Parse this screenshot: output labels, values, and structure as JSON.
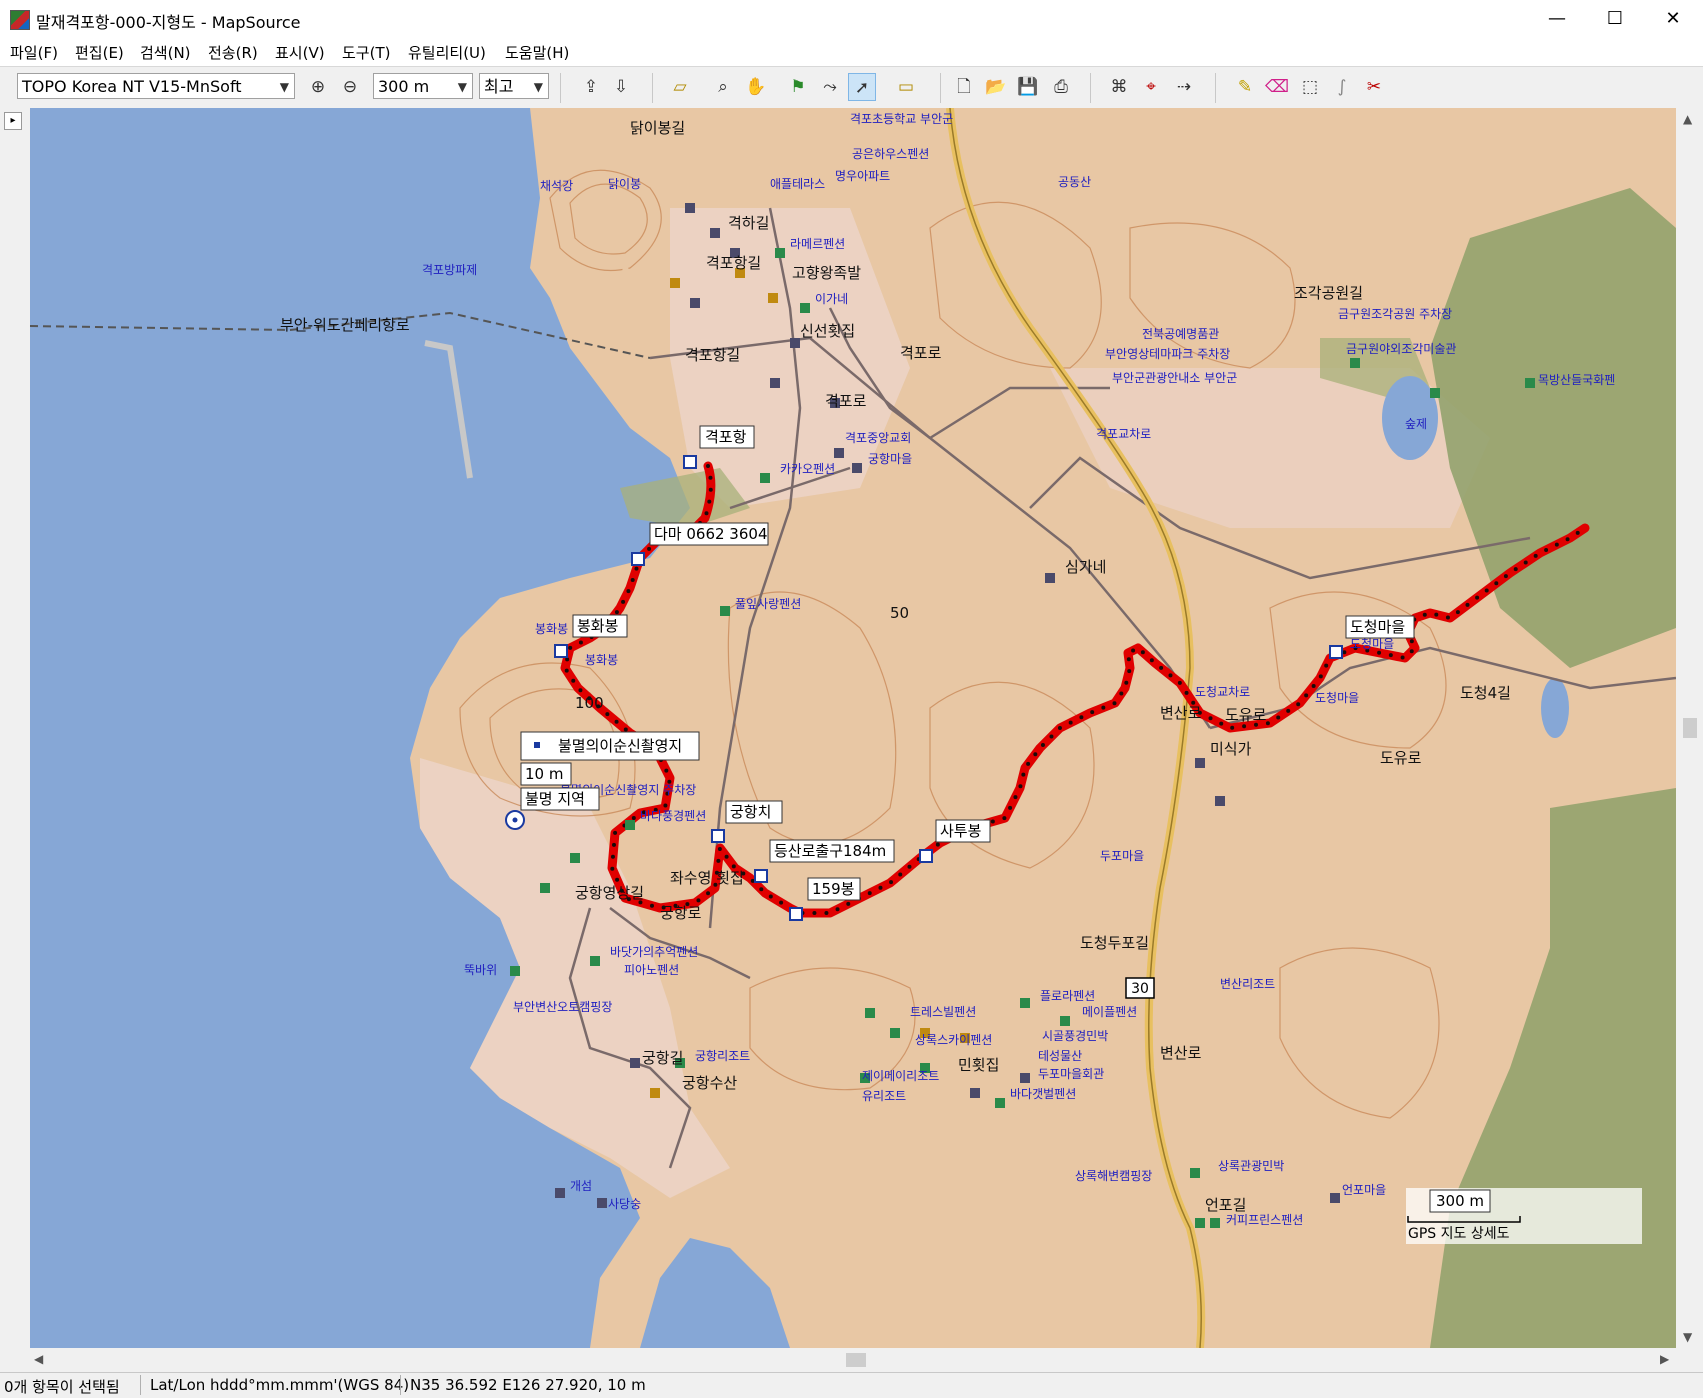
{
  "window": {
    "title": "말재격포항-000-지형도 - MapSource",
    "minimize_glyph": "—",
    "maximize_glyph": "☐",
    "close_glyph": "✕"
  },
  "menu": [
    "파일(F)",
    "편집(E)",
    "검색(N)",
    "전송(R)",
    "표시(V)",
    "도구(T)",
    "유틸리티(U)",
    "도움말(H)"
  ],
  "toolbar": {
    "map_product": "TOPO Korea NT V15-MnSoft",
    "zoom_scale": "300 m",
    "detail_level": "최고",
    "icons": [
      "zoom-in-icon",
      "zoom-out-icon",
      "receive-from-device-icon",
      "send-to-device-icon",
      "select-map-icon",
      "zoom-tool-icon",
      "hand-tool-icon",
      "waypoint-tool-icon",
      "route-tool-icon",
      "selection-tool-icon",
      "measure-tool-icon",
      "new-file-icon",
      "open-file-icon",
      "save-file-icon",
      "print-icon",
      "find-icon",
      "find-near-icon",
      "find-route-icon",
      "draw-track-icon",
      "erase-track-icon",
      "select-track-icon",
      "divide-track-icon",
      "join-track-icon"
    ]
  },
  "map": {
    "labels": {
      "gyeokpohang": "격포항",
      "dama": "다마 0662 3604",
      "bonghwabong": "봉화봉",
      "bulmyeong_poi": "불멸의이순신촬영지",
      "elevation": "10 m",
      "unknown_area": "불명 지역",
      "gunghangchi": "궁항치",
      "exit": "등산로출구184m",
      "peak159": "159봉",
      "satubong": "사투봉",
      "docheong": "도청마을",
      "route30": "30"
    },
    "place_names": {
      "dalibonggil": "닭이봉길",
      "dalibong": "닭이봉",
      "chaeseokgang": "채석강",
      "gyeokpo_breakwater": "격포방파제",
      "ferry": "부안-위도간페리항로",
      "gyeokhagil": "격하길",
      "gyeokpohanggil": "격포항길",
      "gyeokpohanggil2": "격포항길",
      "gohyangwang": "고향왕족발",
      "sinseon": "신선횟집",
      "gyeokporo": "격포로",
      "gyeokporo2": "격포로",
      "school": "격포초등학교 부안군",
      "gongeunhausu": "공은하우스펜션",
      "apple": "애플테라스",
      "apt": "명우아파트",
      "lamere": "라메르펜션",
      "igane": "이가네",
      "gongdongsan": "공동산",
      "jeonbuk": "전북공예명품관",
      "parking1": "부안영상테마파크 주차장",
      "tourist": "부안군관광안내소 부안군",
      "gyeokpo_ic": "격포교차로",
      "jogak_road": "조각공원길",
      "geumgu_parking": "금구원조각공원 주차장",
      "geumgu_museum": "금구원야외조각미술관",
      "sup": "숲제",
      "mokbangsan": "목방산들국화펜",
      "simgane": "심가네",
      "kakao": "카카오펜션",
      "gyeokpo_church": "격포중앙교회",
      "gunghangmaeul": "궁항마을",
      "pulip": "풀잎사랑펜션",
      "contour50": "50",
      "contour100": "100",
      "bonghwabong_small": "봉화봉",
      "bonghwabong_small2": "봉화봉",
      "docheong_ic": "도청교차로",
      "docheongmaeul2": "도청마을",
      "docheongmaeul3": "도청마을",
      "doyuro": "도유로",
      "doyuro2": "도유로",
      "misikga": "미식가",
      "docheong4gil": "도청4길",
      "byeonsanro": "변산로",
      "byeonsanro2": "변산로",
      "dopyeondurogil": "도청두포길",
      "dupo": "두포마을",
      "jasu": "좌수영 횟집",
      "seashore": "바다풍경펜션",
      "parking2": "불멸의이순신촬영지 주차장",
      "gunghangyeongsang": "궁항영상길",
      "gunghangro": "궁항로",
      "badatga": "바닷가의추억펜션",
      "piano": "피아노펜션",
      "ttukbawi": "뚝바위",
      "auto_camp": "부안변산오토캠핑장",
      "gunghangresort": "궁항리조트",
      "gunghangsusan": "궁항수산",
      "gunghang_road": "궁항길",
      "terrace": "트레스빌펜션",
      "sky": "상록스카이펜션",
      "minhoe": "민횟집",
      "jamairi": "제이메이리조트",
      "yuri": "유리조트",
      "flora": "플로라펜션",
      "maple": "메이플펜션",
      "sigol": "시골풍경민박",
      "teseong": "테성물산",
      "dupohall": "두포마을회관",
      "badagaet": "바다갯벌펜션",
      "byeonsanresort": "변산리조트",
      "sangnokcamp": "상록해변캠핑장",
      "sangnokguest": "상록관광민박",
      "eonpo": "언포마을",
      "eonpogil": "언포길",
      "coffee": "커피프린스펜션",
      "gaeseom": "개섬",
      "sadangsu": "사당숭",
      "distance_label": "300 m",
      "legend_label": "GPS 지도 상세도"
    },
    "colors": {
      "sea": "#86a7d6",
      "land": "#e8c7a4",
      "track": "#e00000",
      "track_dots": "#1a0a0a",
      "road_major": "#e8c060",
      "road_minor": "#7a6a6a",
      "label_poi": "#2020c0",
      "contour": "#c98a5a",
      "forest": "#8ea06a"
    }
  },
  "status": {
    "selection": "0개 항목이 선택됨",
    "coord_format": "Lat/Lon hddd°mm.mmm'(WGS 84)",
    "position": "N35 36.592 E126 27.920, 10 m"
  }
}
